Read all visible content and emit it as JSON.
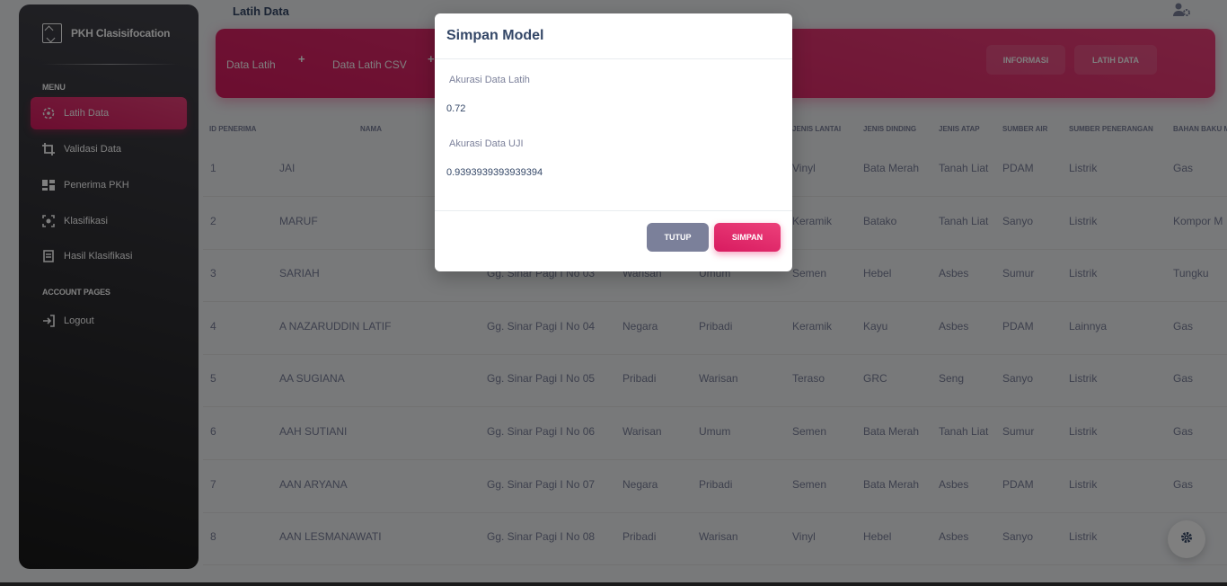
{
  "brand": {
    "name": "PKH Clasisifocation"
  },
  "sidebar": {
    "menu_title": "MENU",
    "items": [
      {
        "label": "Latih Data",
        "icon": "target-icon"
      },
      {
        "label": "Validasi Data",
        "icon": "crop-icon"
      },
      {
        "label": "Penerima PKH",
        "icon": "dashboard-icon"
      },
      {
        "label": "Klasifikasi",
        "icon": "focus-icon"
      },
      {
        "label": "Hasil Klasifikasi",
        "icon": "receipt-icon"
      }
    ],
    "account_title": "ACCOUNT PAGES",
    "logout": {
      "label": "Logout",
      "icon": "login-icon"
    }
  },
  "header": {
    "title": "Latih Data"
  },
  "banner": {
    "tab1": "Data Latih",
    "tab2": "Data Latih CSV",
    "plus": "+",
    "btn_info": "INFORMASI",
    "btn_latih": "LATIH DATA"
  },
  "table": {
    "headers": [
      "ID PENERIMA",
      "NAMA",
      "JENIS LANTAI",
      "JENIS DINDING",
      "JENIS ATAP",
      "SUMBER AIR",
      "SUMBER PENERANGAN",
      "BAHAN BAKU M"
    ],
    "rows": [
      [
        "1",
        "JAI",
        "",
        "",
        "",
        "Vinyl",
        "Bata Merah",
        "Tanah Liat",
        "PDAM",
        "Listrik",
        "Gas"
      ],
      [
        "2",
        "MARUF",
        "",
        "",
        "",
        "Keramik",
        "Batako",
        "Tanah Liat",
        "Sanyo",
        "Listrik",
        "Kompor M"
      ],
      [
        "3",
        "SARIAH",
        "Gg. Sinar Pagi I No 03",
        "Warisan",
        "Umum",
        "Semen",
        "Hebel",
        "Asbes",
        "Sumur",
        "Listrik",
        "Tungku"
      ],
      [
        "4",
        "A NAZARUDDIN LATIF",
        "Gg. Sinar Pagi I No 04",
        "Negara",
        "Pribadi",
        "Keramik",
        "Kayu",
        "Asbes",
        "PDAM",
        "Lainnya",
        "Gas"
      ],
      [
        "5",
        "AA SUGIANA",
        "Gg. Sinar Pagi I No 05",
        "Pribadi",
        "Warisan",
        "Teraso",
        "GRC",
        "Seng",
        "Sanyo",
        "Listrik",
        "Gas"
      ],
      [
        "6",
        "AAH SUTIANI",
        "Gg. Sinar Pagi I No 06",
        "Warisan",
        "Umum",
        "Semen",
        "Bata Merah",
        "Tanah Liat",
        "Sumur",
        "Listrik",
        "Gas"
      ],
      [
        "7",
        "AAN ARYANA",
        "Gg. Sinar Pagi I No 07",
        "Negara",
        "Pribadi",
        "Semen",
        "Bata Merah",
        "Asbes",
        "PDAM",
        "Listrik",
        "Gas"
      ],
      [
        "8",
        "AAN LESMANAWATI",
        "Gg. Sinar Pagi I No 08",
        "Pribadi",
        "Warisan",
        "Vinyl",
        "Hebel",
        "Asbes",
        "Sanyo",
        "Listrik",
        ""
      ]
    ]
  },
  "modal": {
    "title": "Simpan Model",
    "label_latih": "Akurasi Data Latih",
    "value_latih": "0.72",
    "label_uji": "Akurasi Data UJI",
    "value_uji": "0.9393939393939394",
    "btn_close": "TUTUP",
    "btn_save": "SIMPAN"
  },
  "colors": {
    "accent": "#e91e63",
    "sidebar": "#191919",
    "muted": "#7b809a"
  }
}
